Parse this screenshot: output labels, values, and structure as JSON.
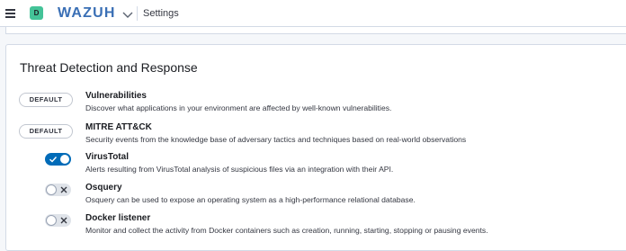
{
  "header": {
    "menu_icon": "hamburger-icon",
    "space_initial": "D",
    "space_color": "#44c398",
    "logo_text": "WAZUH",
    "logo_color": "#3a6fb5",
    "app_menu_icon": "chevron-down-icon",
    "breadcrumb": "Settings"
  },
  "section": {
    "title": "Threat Detection and Response",
    "accent_color": "#006bb8",
    "items": [
      {
        "control": "default-button",
        "control_label": "DEFAULT",
        "title": "Vulnerabilities",
        "description": "Discover what applications in your environment are affected by well-known vulnerabilities."
      },
      {
        "control": "default-button",
        "control_label": "DEFAULT",
        "title": "MITRE ATT&CK",
        "description": "Security events from the knowledge base of adversary tactics and techniques based on real-world observations"
      },
      {
        "control": "toggle",
        "enabled": true,
        "title": "VirusTotal",
        "description": "Alerts resulting from VirusTotal analysis of suspicious files via an integration with their API."
      },
      {
        "control": "toggle",
        "enabled": false,
        "title": "Osquery",
        "description": "Osquery can be used to expose an operating system as a high-performance relational database."
      },
      {
        "control": "toggle",
        "enabled": false,
        "title": "Docker listener",
        "description": "Monitor and collect the activity from Docker containers such as creation, running, starting, stopping or pausing events."
      }
    ]
  }
}
